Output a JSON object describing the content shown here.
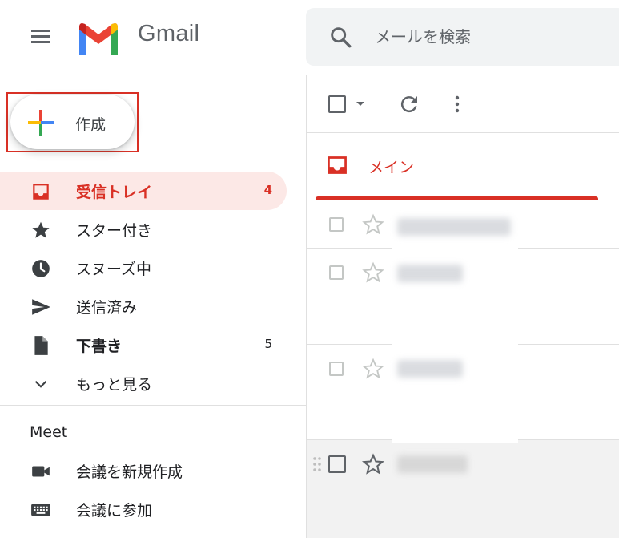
{
  "header": {
    "brand": "Gmail",
    "search_placeholder": "メールを検索",
    "icons": [
      "menu-icon",
      "gmail-logo",
      "search-icon"
    ]
  },
  "compose": {
    "label": "作成",
    "highlight_color": "#d93025"
  },
  "sidebar": {
    "items": [
      {
        "label": "受信トレイ",
        "count": "4",
        "icon": "inbox-icon",
        "active": true
      },
      {
        "label": "スター付き",
        "count": "",
        "icon": "star-icon"
      },
      {
        "label": "スヌーズ中",
        "count": "",
        "icon": "clock-icon"
      },
      {
        "label": "送信済み",
        "count": "",
        "icon": "send-icon"
      },
      {
        "label": "下書き",
        "count": "5",
        "icon": "draft-icon",
        "bold": true
      },
      {
        "label": "もっと見る",
        "count": "",
        "icon": "chevron-down-icon"
      }
    ],
    "meet": {
      "heading": "Meet",
      "items": [
        {
          "label": "会議を新規作成",
          "icon": "video-icon"
        },
        {
          "label": "会議に参加",
          "icon": "keyboard-icon"
        }
      ]
    }
  },
  "toolbar": {
    "icons": [
      "select-all-checkbox",
      "select-dropdown-icon",
      "refresh-icon",
      "more-vert-icon"
    ]
  },
  "tabs": [
    {
      "label": "メイン",
      "icon": "inbox-tab-icon",
      "active": true
    }
  ],
  "colors": {
    "accent": "#d93025",
    "active_bg": "#fce8e6",
    "search_bg": "#f1f3f4",
    "icon_gray": "#5f6368"
  }
}
